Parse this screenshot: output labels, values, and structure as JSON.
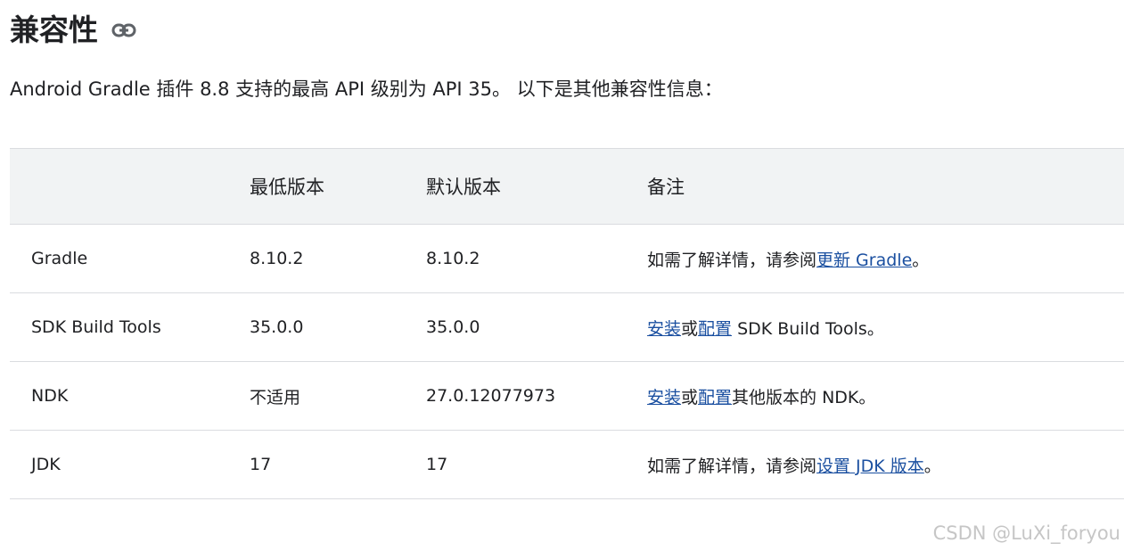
{
  "heading": {
    "title": "兼容性",
    "icon": "link-icon"
  },
  "intro": "Android Gradle 插件 8.8 支持的最高 API 级别为 API 35。 以下是其他兼容性信息：",
  "table": {
    "headers": [
      "",
      "最低版本",
      "默认版本",
      "备注"
    ],
    "rows": [
      {
        "name": "Gradle",
        "min": "8.10.2",
        "default": "8.10.2",
        "note": {
          "prefix": "如需了解详情，请参阅",
          "link1": "更新 Gradle",
          "middle": "",
          "link2": "",
          "suffix": "。"
        }
      },
      {
        "name": "SDK Build Tools",
        "min": "35.0.0",
        "default": "35.0.0",
        "note": {
          "prefix": "",
          "link1": "安装",
          "middle": "或",
          "link2": "配置",
          "suffix": " SDK Build Tools。"
        }
      },
      {
        "name": "NDK",
        "min": "不适用",
        "default": "27.0.12077973",
        "note": {
          "prefix": "",
          "link1": "安装",
          "middle": "或",
          "link2": "配置",
          "suffix": "其他版本的 NDK。"
        }
      },
      {
        "name": "JDK",
        "min": "17",
        "default": "17",
        "note": {
          "prefix": "如需了解详情，请参阅",
          "link1": "设置 JDK 版本",
          "middle": "",
          "link2": "",
          "suffix": "。"
        }
      }
    ]
  },
  "watermark": "CSDN @LuXi_foryou",
  "colors": {
    "link": "#1a4fa0",
    "header_bg": "#f1f3f4",
    "border": "#dadce0",
    "text": "#202124",
    "watermark": "#c6c6c6"
  }
}
